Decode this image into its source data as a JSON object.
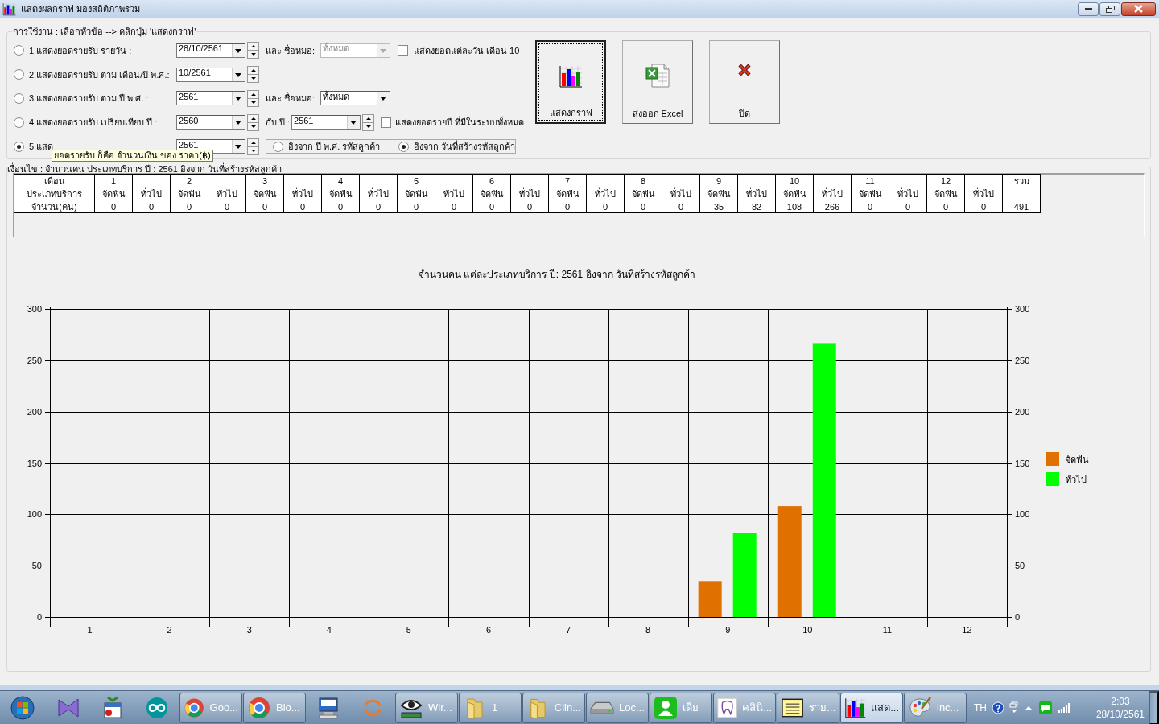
{
  "window": {
    "title": "แสดงผลกราฟ มองสถิติภาพรวม"
  },
  "options_group": {
    "legend": "การใช้งาน : เลือกหัวข้อ  --> คลิกปุ่ม 'แสดงกราฟ'",
    "options": [
      {
        "label": "1.แสดงยอดรายรับ รายวัน :",
        "selected": false,
        "value": "28/10/2561",
        "doctor": {
          "label": "และ ชื่อหมอ:",
          "value": "ทั้งหมด",
          "disabled": true
        },
        "checkbox": {
          "label": "แสดงยอดแต่ละวัน เดือน 10",
          "checked": false
        }
      },
      {
        "label": "2.แสดงยอดรายรับ ตาม เดือน/ปี พ.ศ.:",
        "selected": false,
        "value": "10/2561"
      },
      {
        "label": "3.แสดงยอดรายรับ  ตาม ปี พ.ศ. :",
        "selected": false,
        "value": "2561",
        "doctor": {
          "label": "และ ชื่อหมอ:",
          "value": "ทั้งหมด",
          "disabled": false
        }
      },
      {
        "label": "4.แสดงยอดรายรับ เปรียบเทียบ ปี :",
        "selected": false,
        "value": "2560",
        "compare": {
          "label": "กับ ปี :",
          "value": "2561"
        },
        "checkbox": {
          "label": "แสดงยอดรายปี ที่มีในระบบทั้งหมด",
          "checked": false
        }
      },
      {
        "label": "5.แสด",
        "selected": true,
        "value": "2561",
        "basis": [
          {
            "label": "อิงจาก ปี พ.ศ. รหัสลูกค้า",
            "selected": false
          },
          {
            "label": "อิงจาก วันที่สร้างรหัสลูกค้า",
            "selected": true
          }
        ]
      }
    ],
    "tooltip": "ยอดรายรับ ก็คือ จำนวนเงิน ของ ราคา(฿)"
  },
  "buttons": [
    {
      "kind": "chart",
      "label": "แสดงกราฟ",
      "focused": true
    },
    {
      "kind": "excel",
      "label": "ส่งออก Excel",
      "focused": false
    },
    {
      "kind": "close",
      "label": "ปิด",
      "focused": false
    }
  ],
  "summary": {
    "title": "เงื่อนไข :  จำนวนคน ประเภทบริการ ปี : 2561 อิงจาก วันที่สร้างรหัสลูกค้า",
    "table": {
      "month_label": "เดือน",
      "type_label": "ประเภทบริการ",
      "count_label": "จำนวน(คน)",
      "total_label": "รวม",
      "total": "491",
      "months": [
        {
          "month": "1",
          "types": [
            "จัดฟัน",
            "ทั่วไป"
          ],
          "counts": [
            "0",
            "0"
          ]
        },
        {
          "month": "2",
          "types": [
            "จัดฟัน",
            "ทั่วไป"
          ],
          "counts": [
            "0",
            "0"
          ]
        },
        {
          "month": "3",
          "types": [
            "จัดฟัน",
            "ทั่วไป"
          ],
          "counts": [
            "0",
            "0"
          ]
        },
        {
          "month": "4",
          "types": [
            "จัดฟัน",
            "ทั่วไป"
          ],
          "counts": [
            "0",
            "0"
          ]
        },
        {
          "month": "5",
          "types": [
            "จัดฟัน",
            "ทั่วไป"
          ],
          "counts": [
            "0",
            "0"
          ]
        },
        {
          "month": "6",
          "types": [
            "จัดฟัน",
            "ทั่วไป"
          ],
          "counts": [
            "0",
            "0"
          ]
        },
        {
          "month": "7",
          "types": [
            "จัดฟัน",
            "ทั่วไป"
          ],
          "counts": [
            "0",
            "0"
          ]
        },
        {
          "month": "8",
          "types": [
            "จัดฟัน",
            "ทั่วไป"
          ],
          "counts": [
            "0",
            "0"
          ]
        },
        {
          "month": "9",
          "types": [
            "จัดฟัน",
            "ทั่วไป"
          ],
          "counts": [
            "35",
            "82"
          ]
        },
        {
          "month": "10",
          "types": [
            "จัดฟัน",
            "ทั่วไป"
          ],
          "counts": [
            "108",
            "266"
          ]
        },
        {
          "month": "11",
          "types": [
            "จัดฟัน",
            "ทั่วไป"
          ],
          "counts": [
            "0",
            "0"
          ]
        },
        {
          "month": "12",
          "types": [
            "จัดฟัน",
            "ทั่วไป"
          ],
          "counts": [
            "0",
            "0"
          ]
        }
      ]
    },
    "chart_data": {
      "type": "bar",
      "title": "จำนวนคน แต่ละประเภทบริการ  ปี: 2561 อิงจาก วันที่สร้างรหัสลูกค้า",
      "categories": [
        "1",
        "2",
        "3",
        "4",
        "5",
        "6",
        "7",
        "8",
        "9",
        "10",
        "11",
        "12"
      ],
      "series": [
        {
          "name": "จัดฟัน",
          "color": "#e07000",
          "values": [
            0,
            0,
            0,
            0,
            0,
            0,
            0,
            0,
            35,
            108,
            0,
            0
          ]
        },
        {
          "name": "ทั่วไป",
          "color": "#00ff00",
          "values": [
            0,
            0,
            0,
            0,
            0,
            0,
            0,
            0,
            82,
            266,
            0,
            0
          ]
        }
      ],
      "ylim": [
        0,
        300
      ],
      "yticks": [
        0,
        50,
        100,
        150,
        200,
        250,
        300
      ],
      "grid": true,
      "legend": true
    },
    "right_axis_labels": [
      "300",
      "250",
      "200",
      "150",
      "100",
      "50",
      "0"
    ]
  },
  "taskbar": {
    "items": [
      {
        "kind": "start",
        "selected": false
      },
      {
        "kind": "ribbon",
        "selected": false
      },
      {
        "kind": "calendar",
        "selected": false
      },
      {
        "kind": "infinity",
        "selected": false
      },
      {
        "kind": "browser",
        "label": "Goo...",
        "selected": false
      },
      {
        "kind": "browser",
        "label": "Blo...",
        "selected": false
      },
      {
        "kind": "computer",
        "selected": false
      },
      {
        "kind": "arrows",
        "selected": false
      },
      {
        "kind": "eye",
        "label": "Wir...",
        "selected": false
      },
      {
        "kind": "folder",
        "label": "1",
        "selected": false
      },
      {
        "kind": "folder",
        "label": "Clin...",
        "selected": false
      },
      {
        "kind": "drive",
        "label": "Loc...",
        "selected": false
      },
      {
        "kind": "person",
        "label": "เดีย",
        "selected": false
      },
      {
        "kind": "tooth",
        "label": "คลินิ...",
        "selected": false
      },
      {
        "kind": "notepad",
        "label": "ราย...",
        "selected": false
      },
      {
        "kind": "chart",
        "label": "แสด...",
        "selected": true
      },
      {
        "kind": "palette",
        "label": "inc...",
        "selected": false
      }
    ],
    "language": "TH",
    "time": "2:03",
    "date": "28/10/2561"
  }
}
